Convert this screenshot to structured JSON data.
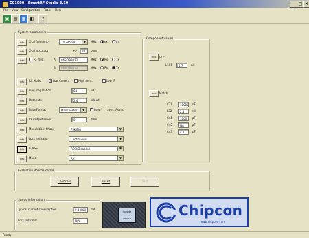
{
  "window": {
    "title": "CC1000 - SmartRF Studio 3.10",
    "controls": {
      "minimize": "_",
      "maximize": "□",
      "close": "×"
    }
  },
  "menu": [
    "File",
    "View",
    "Configuration",
    "Tools",
    "Help"
  ],
  "toolbar": [
    "new-icon",
    "open-icon",
    "save-icon",
    "print-icon",
    "help-icon"
  ],
  "system_parameters": {
    "title": "System parameters",
    "button_label": "Info",
    "xtal": {
      "label": "X-tal frequency",
      "value": "14.745600",
      "unit": "MHz",
      "radio_a": "ext",
      "radio_b": "Int"
    },
    "ref_freq": {
      "label": "X-tal accuracy",
      "prefix": "+/-",
      "value": "10",
      "unit": "ppm"
    },
    "rf_freq": {
      "label": "RF freq.",
      "row_a_label": "A",
      "row_a_value": "868.299872",
      "row_a_unit": "MHz",
      "row_a_radio_a": "Rx",
      "row_a_radio_b": "Tx",
      "row_b_label": "B",
      "row_b_value": "868.299872",
      "row_b_unit": "MHz",
      "row_b_radio_a": "Rx",
      "row_b_radio_b": "Tx"
    },
    "rx_mode": {
      "label": "RX Mode",
      "opt1": "Low Current",
      "opt2": "High sens.",
      "opt3": "Low IF"
    },
    "freq_separation": {
      "label": "Freq. separation",
      "value": "64",
      "unit": "kHz"
    },
    "data_rate": {
      "label": "Data rate",
      "value": "2.4",
      "unit": "kBaud"
    },
    "data_format": {
      "label": "Data Format",
      "value": "Manchester",
      "opt1": "Fsep*",
      "opt2": "Sync./Async"
    },
    "rf_output_power": {
      "label": "RF Output Power",
      "value": "0",
      "unit": "dBm"
    },
    "modulation": {
      "label": "Modulation: Shape",
      "value": "FSK-Bin"
    },
    "lock_indicator": {
      "label": "Lock indicator",
      "value": "Continuous"
    },
    "if_rssi": {
      "label": "IF/RSSI",
      "value": "RSSI/Disabled"
    },
    "mode": {
      "label": "Mode",
      "value": "RX"
    }
  },
  "component_values": {
    "title": "Component values",
    "button_label": "Info",
    "vco_label": "VCO",
    "vco_fields": [
      {
        "label": "L101",
        "value": "4.7",
        "unit": "nH"
      }
    ],
    "match_label": "Match",
    "match_fields": [
      {
        "label": "C31",
        "value": "10000",
        "unit": "nF"
      },
      {
        "label": "L32",
        "value": "2.5",
        "unit": "nH"
      },
      {
        "label": "C41",
        "value": "1000",
        "unit": "pF"
      },
      {
        "label": "C42",
        "value": "NA",
        "unit": "pF"
      },
      {
        "label": "C43",
        "value": "4.7",
        "unit": "pF"
      }
    ]
  },
  "eval_board": {
    "title": "Evaluation Board Control",
    "calibrate": "Calibrate",
    "reset": "Reset",
    "third": "Test"
  },
  "status_info": {
    "title": "Status information",
    "current_label": "Typical current consumption",
    "current_value": "9.3 (RX)",
    "current_unit": "mA",
    "lock_label": "Lock indicator",
    "lock_value": "N/A"
  },
  "update_button": {
    "label": "Update device"
  },
  "logo": {
    "brand": "Chipcon",
    "url": "www.chipcon.com",
    "accent": "#1c3ea8"
  },
  "status_bar": {
    "text": "Ready"
  }
}
